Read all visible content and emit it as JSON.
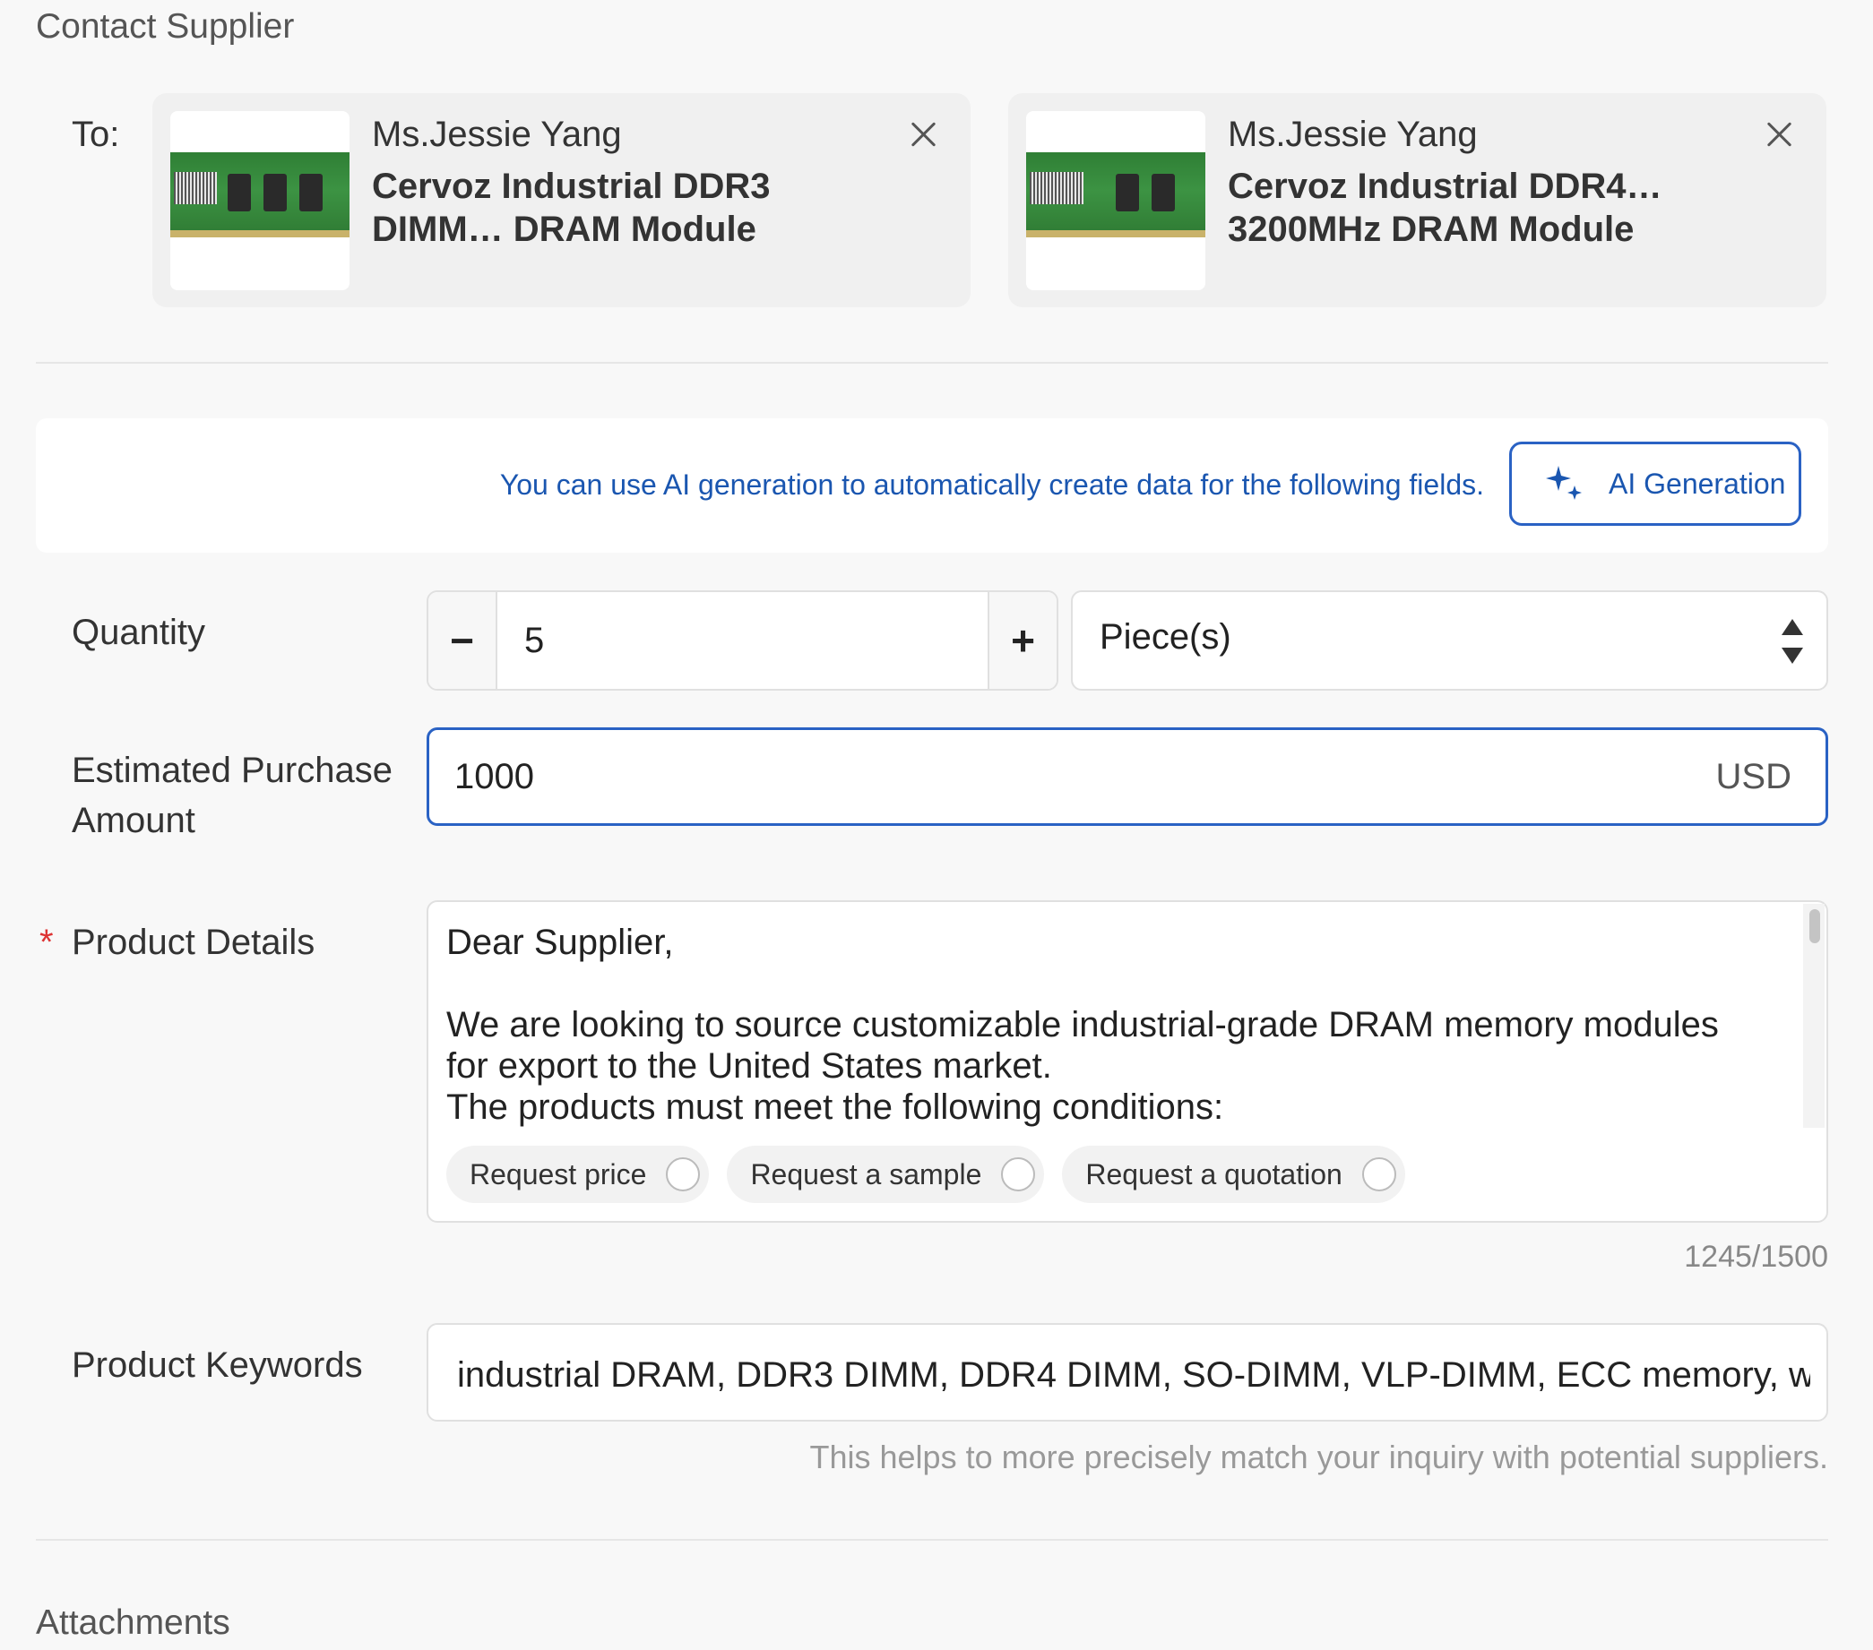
{
  "header": {
    "title": "Contact Supplier"
  },
  "recipients": {
    "to_label": "To:",
    "cards": [
      {
        "supplier": "Ms.Jessie Yang",
        "product": "Cervoz Industrial DDR3 DIMM… DRAM Module",
        "image_icon": "dram-module-thumbnail",
        "remove_icon": "close-icon"
      },
      {
        "supplier": "Ms.Jessie Yang",
        "product": "Cervoz Industrial DDR4… 3200MHz DRAM Module",
        "image_icon": "dram-module-thumbnail",
        "remove_icon": "close-icon"
      }
    ]
  },
  "ai": {
    "hint": "You can use AI generation to automatically create data for the following fields.",
    "button_label": "AI Generation",
    "icon": "sparkle-icon"
  },
  "quantity": {
    "label": "Quantity",
    "value": "5",
    "minus": "−",
    "plus": "+",
    "unit": "Piece(s)"
  },
  "amount": {
    "label": "Estimated Purchase Amount",
    "value": "1000",
    "currency": "USD"
  },
  "details": {
    "required_mark": "*",
    "label": "Product Details",
    "text": "Dear Supplier,\n\nWe are looking to source customizable industrial-grade DRAM memory modules for export to the United States market.\nThe products must meet the following conditions:",
    "options": [
      "Request price",
      "Request a sample",
      "Request a quotation"
    ],
    "char_count": "1245/1500"
  },
  "keywords": {
    "label": "Product Keywords",
    "value": "industrial DRAM, DDR3 DIMM, DDR4 DIMM, SO-DIMM, VLP-DIMM, ECC memory, wide",
    "help": "This helps to more precisely match your inquiry with potential suppliers."
  },
  "attachments": {
    "title": "Attachments"
  },
  "colors": {
    "accent": "#2a62c4",
    "link": "#1a56b0",
    "required": "#dd3333",
    "module_pcb": "#3c9343"
  }
}
